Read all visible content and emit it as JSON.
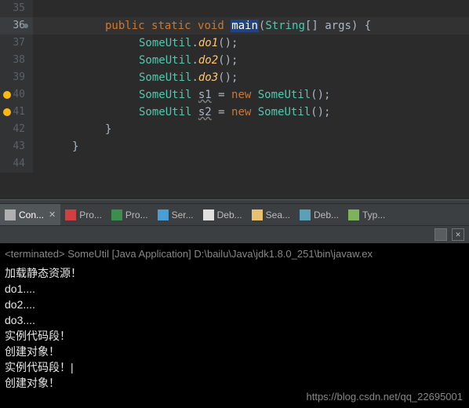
{
  "editor": {
    "lines": [
      {
        "num": "35",
        "parts": []
      },
      {
        "num": "36",
        "highlighted": true,
        "dot": true,
        "indent": 2,
        "parts": [
          {
            "t": "public ",
            "c": "kw-public"
          },
          {
            "t": "static ",
            "c": "kw-static"
          },
          {
            "t": "void ",
            "c": "kw-void"
          },
          {
            "t": "main",
            "c": "method-name boxed"
          },
          {
            "t": "(",
            "c": "paren"
          },
          {
            "t": "String",
            "c": "string-type"
          },
          {
            "t": "[] ",
            "c": "bracket"
          },
          {
            "t": "args",
            "c": "param"
          },
          {
            "t": ") ",
            "c": "paren"
          },
          {
            "t": "{",
            "c": "brace"
          }
        ]
      },
      {
        "num": "37",
        "indent": 3,
        "parts": [
          {
            "t": "SomeUtil",
            "c": "class-ref"
          },
          {
            "t": ".",
            "c": "plain"
          },
          {
            "t": "do1",
            "c": "method"
          },
          {
            "t": "();",
            "c": "plain"
          }
        ]
      },
      {
        "num": "38",
        "indent": 3,
        "parts": [
          {
            "t": "SomeUtil",
            "c": "class-ref"
          },
          {
            "t": ".",
            "c": "plain"
          },
          {
            "t": "do2",
            "c": "method"
          },
          {
            "t": "();",
            "c": "plain"
          }
        ]
      },
      {
        "num": "39",
        "indent": 3,
        "parts": [
          {
            "t": "SomeUtil",
            "c": "class-ref"
          },
          {
            "t": ".",
            "c": "plain"
          },
          {
            "t": "do3",
            "c": "method"
          },
          {
            "t": "();",
            "c": "plain"
          }
        ]
      },
      {
        "num": "40",
        "bulb": true,
        "indent": 3,
        "parts": [
          {
            "t": "SomeUtil ",
            "c": "class-ref"
          },
          {
            "t": "s1",
            "c": "var underwave"
          },
          {
            "t": " = ",
            "c": "plain"
          },
          {
            "t": "new ",
            "c": "kw-new"
          },
          {
            "t": "SomeUtil",
            "c": "class-ref"
          },
          {
            "t": "();",
            "c": "plain"
          }
        ]
      },
      {
        "num": "41",
        "bulb": true,
        "indent": 3,
        "parts": [
          {
            "t": "SomeUtil ",
            "c": "class-ref"
          },
          {
            "t": "s2",
            "c": "var underwave"
          },
          {
            "t": " = ",
            "c": "plain"
          },
          {
            "t": "new ",
            "c": "kw-new"
          },
          {
            "t": "SomeUtil",
            "c": "class-ref"
          },
          {
            "t": "();",
            "c": "plain"
          }
        ]
      },
      {
        "num": "42",
        "indent": 2,
        "parts": [
          {
            "t": "}",
            "c": "brace"
          }
        ]
      },
      {
        "num": "43",
        "indent": 1,
        "parts": [
          {
            "t": "}",
            "c": "brace"
          }
        ]
      },
      {
        "num": "44",
        "parts": []
      }
    ]
  },
  "tabs": [
    {
      "label": "Con...",
      "iconColor": "#b0b0b0",
      "active": true,
      "close": true
    },
    {
      "label": "Pro...",
      "iconColor": "#d04040"
    },
    {
      "label": "Pro...",
      "iconColor": "#3c8f4a"
    },
    {
      "label": "Ser...",
      "iconColor": "#4a9ed6"
    },
    {
      "label": "Deb...",
      "iconColor": "#e0e0e0"
    },
    {
      "label": "Sea...",
      "iconColor": "#e8c070"
    },
    {
      "label": "Deb...",
      "iconColor": "#5aa0b8"
    },
    {
      "label": "Typ...",
      "iconColor": "#7fb35a"
    }
  ],
  "console": {
    "header": "<terminated> SomeUtil [Java Application] D:\\bailu\\Java\\jdk1.8.0_251\\bin\\javaw.ex",
    "lines": [
      "加载静态资源！",
      "do1....",
      "do2....",
      "do3....",
      "实例代码段！",
      "创建对象！",
      "实例代码段！|",
      "创建对象！"
    ]
  },
  "watermark": "https://blog.csdn.net/qq_22695001"
}
